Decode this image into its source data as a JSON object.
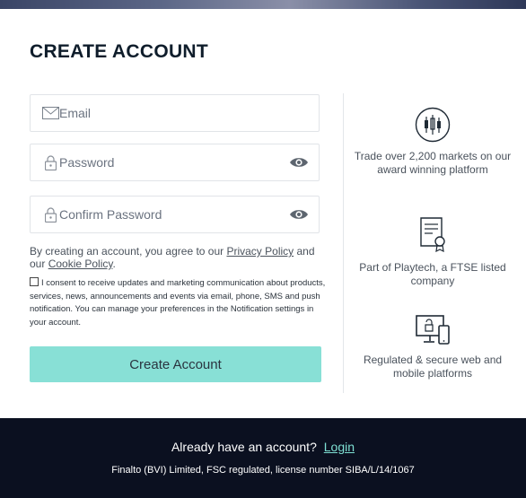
{
  "form": {
    "title": "CREATE ACCOUNT",
    "email_placeholder": "Email",
    "password_placeholder": "Password",
    "confirm_placeholder": "Confirm Password",
    "agree_prefix": "By creating an account, you agree to our ",
    "privacy_link": "Privacy Policy",
    "agree_middle": " and our ",
    "cookie_link": "Cookie Policy",
    "agree_suffix": ".",
    "consent_text": "I consent to receive updates and marketing communication about products, services, news, announcements and events via email, phone, SMS and push notification. You can manage your preferences in the Notification settings in your account.",
    "submit_label": "Create Account"
  },
  "features": [
    {
      "icon": "candlestick-chart-icon",
      "text": "Trade over 2,200 markets on our award winning platform"
    },
    {
      "icon": "certificate-icon",
      "text": "Part of Playtech, a FTSE listed company"
    },
    {
      "icon": "devices-icon",
      "text": "Regulated & secure web and mobile platforms"
    }
  ],
  "footer": {
    "have_account": "Already have an account?",
    "login_link": "Login",
    "legal": "Finalto (BVI) Limited, FSC regulated, license number SIBA/L/14/1067"
  },
  "colors": {
    "accent": "#88e0d6",
    "footer_bg": "#0b1020",
    "login_link": "#7ee0d3"
  }
}
